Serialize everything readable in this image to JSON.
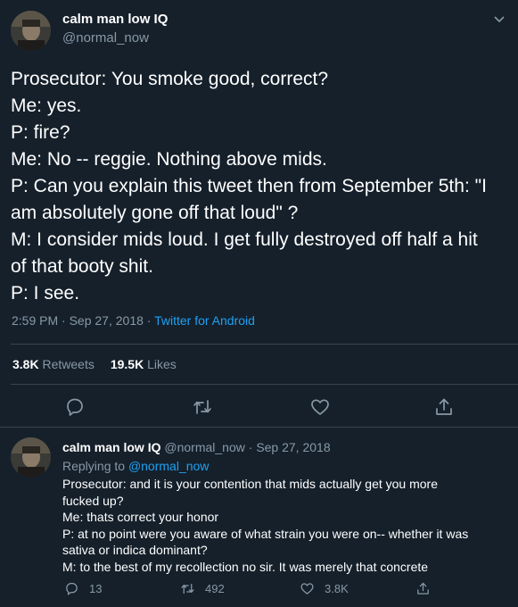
{
  "tweet": {
    "author_name": "calm man low IQ",
    "handle": "@normal_now",
    "lines": [
      "Prosecutor: You smoke good, correct?",
      "Me: yes.",
      "P: fire?",
      "Me: No -- reggie. Nothing above mids.",
      "P: Can you explain this tweet then from September 5th: \"I",
      "am absolutely gone off that loud\" ?",
      "M: I consider mids loud. I get fully destroyed off half a hit",
      "of that booty shit.",
      "P: I see."
    ],
    "time": "2:59 PM",
    "date": "Sep 27, 2018",
    "separator": "·",
    "source": "Twitter for Android",
    "retweets_count": "3.8K",
    "retweets_label": "Retweets",
    "likes_count": "19.5K",
    "likes_label": "Likes",
    "icons": [
      "reply-icon",
      "retweet-icon",
      "like-icon",
      "share-icon"
    ]
  },
  "reply": {
    "author_name": "calm man low IQ",
    "handle": "@normal_now",
    "separator": "·",
    "date": "Sep 27, 2018",
    "replying_prefix": "Replying to",
    "replying_to": "@normal_now",
    "lines": [
      "Prosecutor: and it is your contention that mids actually get you more",
      "fucked up?",
      "Me: thats correct your honor",
      "P: at no point were you aware of what strain you were on-- whether it was",
      "sativa or indica dominant?",
      "M: to the best of my recollection no sir. It was merely that concrete"
    ],
    "reply_count": "13",
    "retweet_count": "492",
    "like_count": "3.8K"
  },
  "colors": {
    "background": "#15202b",
    "text": "#ffffff",
    "secondary": "#8899a6",
    "accent": "#1da1f2",
    "divider": "#38444d"
  }
}
